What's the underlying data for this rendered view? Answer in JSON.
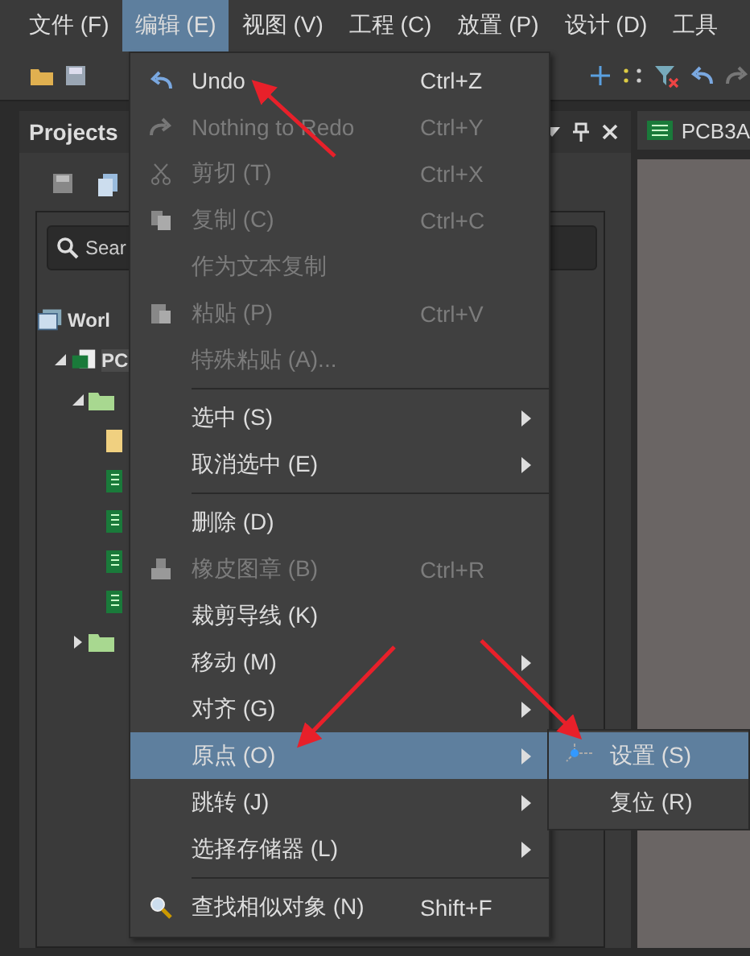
{
  "menubar": [
    {
      "label": "文件 (F)",
      "selected": false
    },
    {
      "label": "编辑 (E)",
      "selected": true
    },
    {
      "label": "视图 (V)",
      "selected": false
    },
    {
      "label": "工程 (C)",
      "selected": false
    },
    {
      "label": "放置 (P)",
      "selected": false
    },
    {
      "label": "设计 (D)",
      "selected": false
    },
    {
      "label": "工具",
      "selected": false
    }
  ],
  "projects_panel": {
    "title": "Projects",
    "search": {
      "placeholder": "Sear"
    },
    "tree": [
      {
        "label": "Worl",
        "kind": "workspace",
        "children": [
          {
            "label": "PC",
            "kind": "project",
            "expanded": true,
            "children": [
              {
                "kind": "folder",
                "expanded": true,
                "children": [
                  {
                    "kind": "file"
                  },
                  {
                    "kind": "pcb"
                  },
                  {
                    "kind": "pcb"
                  },
                  {
                    "kind": "pcb"
                  },
                  {
                    "kind": "pcb"
                  }
                ]
              },
              {
                "kind": "folder",
                "expanded": false
              }
            ]
          }
        ]
      }
    ]
  },
  "document_tab": {
    "label": "PCB3A"
  },
  "edit_menu": {
    "items": [
      {
        "kind": "item",
        "label": "Undo",
        "shortcut": "Ctrl+Z",
        "disabled": false,
        "selected": false
      },
      {
        "kind": "item",
        "label": "Nothing to Redo",
        "shortcut": "Ctrl+Y",
        "disabled": true,
        "selected": false
      },
      {
        "kind": "item",
        "label": "剪切 (T)",
        "shortcut": "Ctrl+X",
        "disabled": true,
        "selected": false
      },
      {
        "kind": "item",
        "label": "复制 (C)",
        "shortcut": "Ctrl+C",
        "disabled": true,
        "selected": false
      },
      {
        "kind": "item",
        "label": "作为文本复制",
        "disabled": true,
        "selected": false
      },
      {
        "kind": "item",
        "label": "粘贴 (P)",
        "shortcut": "Ctrl+V",
        "disabled": true,
        "selected": false
      },
      {
        "kind": "item",
        "label": "特殊粘贴 (A)...",
        "disabled": true,
        "selected": false
      },
      {
        "kind": "separator"
      },
      {
        "kind": "submenu",
        "label": "选中 (S)",
        "disabled": false,
        "selected": false
      },
      {
        "kind": "submenu",
        "label": "取消选中 (E)",
        "disabled": false,
        "selected": false
      },
      {
        "kind": "separator"
      },
      {
        "kind": "item",
        "label": "删除 (D)",
        "disabled": false,
        "selected": false
      },
      {
        "kind": "item",
        "label": "橡皮图章 (B)",
        "shortcut": "Ctrl+R",
        "disabled": true,
        "selected": false
      },
      {
        "kind": "item",
        "label": "裁剪导线 (K)",
        "disabled": false,
        "selected": false
      },
      {
        "kind": "submenu",
        "label": "移动 (M)",
        "disabled": false,
        "selected": false
      },
      {
        "kind": "submenu",
        "label": "对齐 (G)",
        "disabled": false,
        "selected": false
      },
      {
        "kind": "submenu",
        "label": "原点 (O)",
        "disabled": false,
        "selected": true
      },
      {
        "kind": "submenu",
        "label": "跳转 (J)",
        "disabled": false,
        "selected": false
      },
      {
        "kind": "submenu",
        "label": "选择存储器 (L)",
        "disabled": false,
        "selected": false
      },
      {
        "kind": "separator"
      },
      {
        "kind": "item",
        "label": "查找相似对象 (N)",
        "shortcut": "Shift+F",
        "disabled": false,
        "selected": false
      }
    ]
  },
  "origin_submenu": {
    "items": [
      {
        "label": "设置 (S)",
        "selected": true
      },
      {
        "label": "复位 (R)",
        "selected": false
      }
    ]
  }
}
